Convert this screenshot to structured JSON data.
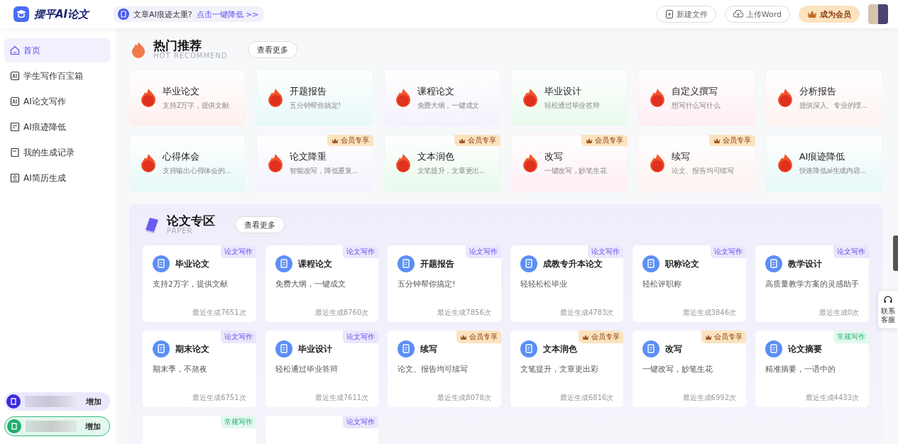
{
  "header": {
    "logo": "摆平AI论文",
    "notice": "文章AI痕迹太重?",
    "notice_link": "点击一键降低 >>",
    "buttons": [
      {
        "label": "新建文件",
        "kind": "new"
      },
      {
        "label": "上传Word",
        "kind": "upload"
      },
      {
        "label": "成为会员",
        "kind": "vip"
      }
    ]
  },
  "sidebar": {
    "items": [
      {
        "label": "首页",
        "selected": true,
        "kind": "home"
      },
      {
        "label": "学生写作百宝箱",
        "selected": false,
        "kind": "ai"
      },
      {
        "label": "AI论文写作",
        "selected": false,
        "kind": "ai"
      },
      {
        "label": "AI痕迹降低",
        "selected": false,
        "kind": "doc"
      },
      {
        "label": "我的生成记录",
        "selected": false,
        "kind": "record"
      },
      {
        "label": "AI简历生成",
        "selected": false,
        "kind": "resume"
      }
    ],
    "bottom": [
      {
        "kind": "purple",
        "action": "增加"
      },
      {
        "kind": "green",
        "action": "增加"
      }
    ]
  },
  "hot": {
    "title": "热门推荐",
    "subtitle": "HOT RECOMMEND",
    "more": "查看更多",
    "cards": [
      {
        "title": "毕业论文",
        "desc": "支持2万字，提供文献",
        "color": "#fdf0ee"
      },
      {
        "title": "开题报告",
        "desc": "五分钟帮你搞定!",
        "color": "#e6f9f8"
      },
      {
        "title": "课程论文",
        "desc": "免费大纲，一键成文",
        "color": "#f4f2fc"
      },
      {
        "title": "毕业设计",
        "desc": "轻松通过毕业答辩",
        "color": "#e9f9ec"
      },
      {
        "title": "自定义撰写",
        "desc": "想写什么写什么",
        "color": "#fdeef3"
      },
      {
        "title": "分析报告",
        "desc": "提供深入、专业的理...",
        "color": "#fdf3f1"
      },
      {
        "title": "心得体会",
        "desc": "支持输出心得体会的...",
        "color": "#e6f9f8"
      },
      {
        "title": "论文降重",
        "desc": "智能改写，降低重复...",
        "color": "#f4f2fc",
        "badge": "会员专享"
      },
      {
        "title": "文本润色",
        "desc": "文笔提升，文章更出...",
        "color": "#e9f9ec",
        "badge": "会员专享"
      },
      {
        "title": "改写",
        "desc": "一键改写，妙笔生花",
        "color": "#fdeef3",
        "badge": "会员专享"
      },
      {
        "title": "续写",
        "desc": "论文、报告均可续写",
        "color": "#fdf3f1",
        "badge": "会员专享"
      },
      {
        "title": "AI痕迹降低",
        "desc": "快速降低ai生成内容...",
        "color": "#e6f9f8"
      }
    ]
  },
  "paper": {
    "title": "论文专区",
    "subtitle": "PAPER",
    "more": "查看更多",
    "cards": [
      {
        "tag": "论文写作",
        "kind": "paper",
        "title": "毕业论文",
        "desc": "支持2万字，提供文献",
        "count": "最近生成7651次"
      },
      {
        "tag": "论文写作",
        "kind": "paper",
        "title": "课程论文",
        "desc": "免费大纲，一键成文",
        "count": "最近生成8760次"
      },
      {
        "tag": "论文写作",
        "kind": "paper",
        "title": "开题报告",
        "desc": "五分钟帮你搞定!",
        "count": "最近生成7856次"
      },
      {
        "tag": "论文写作",
        "kind": "paper",
        "title": "成教专升本论文",
        "desc": "轻轻松松毕业",
        "count": "最近生成4783次"
      },
      {
        "tag": "论文写作",
        "kind": "paper",
        "title": "职称论文",
        "desc": "轻松评职称",
        "count": "最近生成3846次"
      },
      {
        "tag": "论文写作",
        "kind": "paper",
        "title": "教学设计",
        "desc": "高质量教学方案的灵感助手",
        "count": "最近生成0次"
      },
      {
        "tag": "论文写作",
        "kind": "paper",
        "title": "期末论文",
        "desc": "期末季，不熬夜",
        "count": "最近生成6751次"
      },
      {
        "tag": "论文写作",
        "kind": "paper",
        "title": "毕业设计",
        "desc": "轻松通过毕业答辩",
        "count": "最近生成7611次"
      },
      {
        "tag": "会员专享",
        "kind": "vip",
        "title": "续写",
        "desc": "论文、报告均可续写",
        "count": "最近生成8078次"
      },
      {
        "tag": "会员专享",
        "kind": "vip",
        "title": "文本润色",
        "desc": "文笔提升，文章更出彩",
        "count": "最近生成6816次"
      },
      {
        "tag": "会员专享",
        "kind": "vip",
        "title": "改写",
        "desc": "一键改写，妙笔生花",
        "count": "最近生成6992次"
      },
      {
        "tag": "常规写作",
        "kind": "normal",
        "title": "论文摘要",
        "desc": "精准摘要，一语中的",
        "count": "最近生成4433次"
      },
      {
        "tag": "常规写作",
        "kind": "normal"
      },
      {
        "tag": "论文写作",
        "kind": "paper"
      }
    ]
  },
  "support": {
    "label": "联系客服"
  }
}
